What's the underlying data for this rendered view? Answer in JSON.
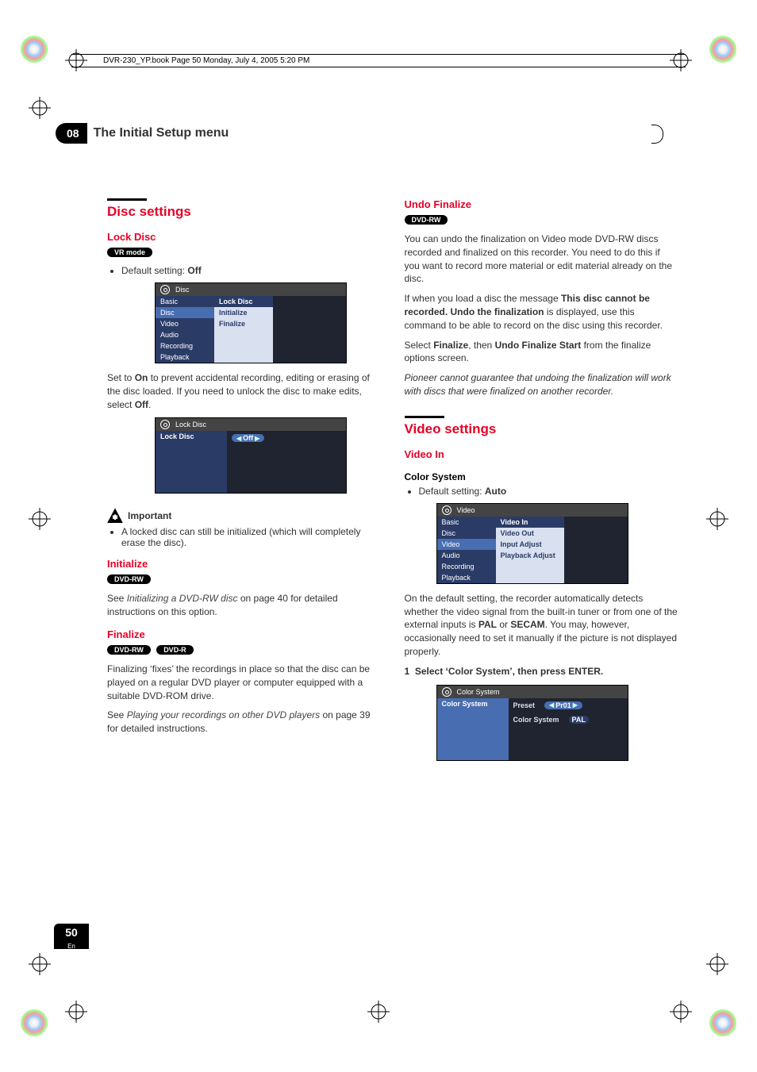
{
  "book_header": "DVR-230_YP.book  Page 50  Monday, July 4, 2005  5:20 PM",
  "chapter_number": "08",
  "chapter_title": "The Initial Setup menu",
  "page_number": "50",
  "page_lang": "En",
  "left": {
    "section": "Disc settings",
    "lockdisc": {
      "title": "Lock Disc",
      "tag": "VR mode",
      "bullet_prefix": "Default setting: ",
      "bullet_value": "Off",
      "osd_title": "Disc",
      "menu_left": [
        "Basic",
        "Disc",
        "Video",
        "Audio",
        "Recording",
        "Playback"
      ],
      "menu_left_active": "Disc",
      "menu_mid": [
        "Lock Disc",
        "Initialize",
        "Finalize"
      ],
      "menu_mid_active": "Lock Disc",
      "body1a": "Set to ",
      "body1_on": "On",
      "body1b": " to prevent accidental recording, editing or erasing of the disc loaded. If you need to unlock the disc to make edits, select ",
      "body1_off": "Off",
      "body1c": ".",
      "osd2_title": "Lock Disc",
      "osd2_label": "Lock Disc",
      "osd2_value": "Off"
    },
    "important": {
      "label": "Important",
      "bullet": "A locked disc can still be initialized (which will completely erase the disc)."
    },
    "initialize": {
      "title": "Initialize",
      "tag": "DVD-RW",
      "body_a": "See ",
      "body_i": "Initializing a DVD-RW disc",
      "body_b": " on page 40 for detailed instructions on this option."
    },
    "finalize": {
      "title": "Finalize",
      "tag1": "DVD-RW",
      "tag2": "DVD-R",
      "body1": "Finalizing ‘fixes’ the recordings in place so that the disc can be played on a regular DVD player or computer equipped with a suitable DVD-ROM drive.",
      "body2_a": "See ",
      "body2_i": "Playing your recordings on other DVD players",
      "body2_b": " on page 39 for detailed instructions."
    }
  },
  "right": {
    "undo": {
      "title": "Undo Finalize",
      "tag": "DVD-RW",
      "body1": "You can undo the finalization on Video mode DVD-RW discs recorded and finalized on this recorder. You need to do this if you want to record more material or edit material already on the disc.",
      "body2_a": "If when you load a disc the message ",
      "body2_b1": "This disc cannot be recorded. Undo the finalization",
      "body2_c": " is displayed, use this command to be able to record on the disc using this recorder.",
      "body3_a": "Select ",
      "body3_b1": "Finalize",
      "body3_b": ", then ",
      "body3_b2": "Undo Finalize Start",
      "body3_c": " from the finalize options screen.",
      "note": "Pioneer cannot guarantee that undoing the finalization will work with discs that were finalized on another recorder."
    },
    "video": {
      "section": "Video settings",
      "videoin": "Video In",
      "colorsystem": "Color System",
      "bullet_prefix": "Default setting: ",
      "bullet_value": "Auto",
      "osd_title": "Video",
      "menu_left": [
        "Basic",
        "Disc",
        "Video",
        "Audio",
        "Recording",
        "Playback"
      ],
      "menu_left_active": "Video",
      "menu_mid": [
        "Video In",
        "Video Out",
        "Input Adjust",
        "Playback Adjust"
      ],
      "menu_mid_active": "Video In",
      "body1_a": "On the default setting, the recorder automatically detects whether the video signal from the built-in tuner or from one of the external inputs is ",
      "body1_pal": "PAL",
      "body1_b": " or ",
      "body1_secam": "SECAM",
      "body1_c": ". You may, however, occasionally need to set it manually if the picture is not displayed properly.",
      "step_num": "1",
      "step_text": "Select ‘Color System’, then press ENTER.",
      "osd2_title": "Color System",
      "osd2_label": "Color System",
      "osd2_row1_l": "Preset",
      "osd2_row1_v": "Pr01",
      "osd2_row2_l": "Color System",
      "osd2_row2_v": "PAL"
    }
  }
}
